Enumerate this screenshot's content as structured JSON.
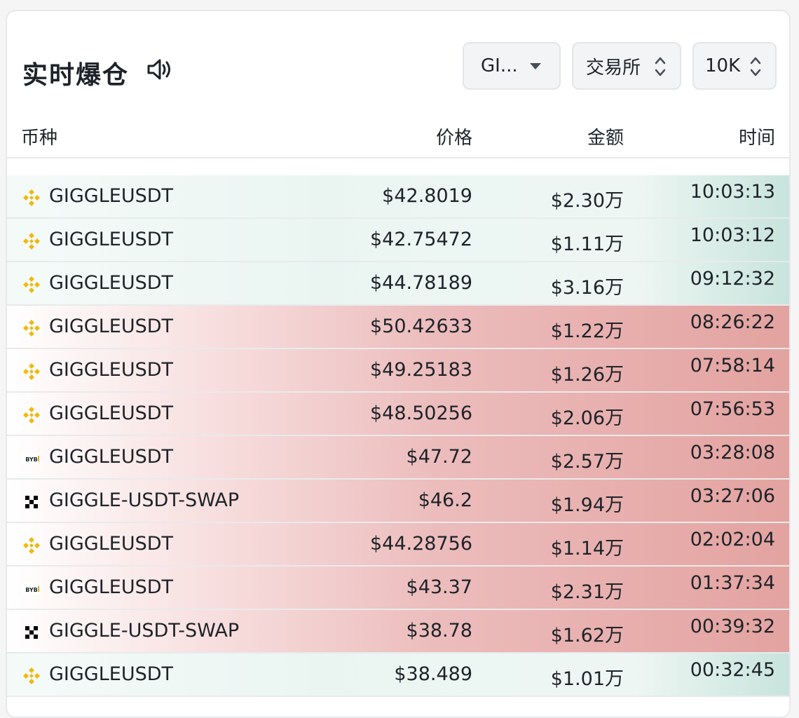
{
  "header": {
    "title": "实时爆仓",
    "coin_filter": "GI...",
    "exchange_filter": "交易所",
    "amount_filter": "10K"
  },
  "columns": [
    "币种",
    "价格",
    "金额",
    "时间"
  ],
  "colors": {
    "long_bg": "#c8e4dc",
    "short_bg": "#e3a3a0",
    "binance": "#f0b90b"
  },
  "rows": [
    {
      "exchange_icon": "binance-icon",
      "side": "long",
      "symbol": "GIGGLEUSDT",
      "price": "$42.8019",
      "amount": "$2.30万",
      "time": "10:03:13"
    },
    {
      "exchange_icon": "binance-icon",
      "side": "long",
      "symbol": "GIGGLEUSDT",
      "price": "$42.75472",
      "amount": "$1.11万",
      "time": "10:03:12"
    },
    {
      "exchange_icon": "binance-icon",
      "side": "long",
      "symbol": "GIGGLEUSDT",
      "price": "$44.78189",
      "amount": "$3.16万",
      "time": "09:12:32"
    },
    {
      "exchange_icon": "binance-icon",
      "side": "short",
      "symbol": "GIGGLEUSDT",
      "price": "$50.42633",
      "amount": "$1.22万",
      "time": "08:26:22"
    },
    {
      "exchange_icon": "binance-icon",
      "side": "short",
      "symbol": "GIGGLEUSDT",
      "price": "$49.25183",
      "amount": "$1.26万",
      "time": "07:58:14"
    },
    {
      "exchange_icon": "binance-icon",
      "side": "short",
      "symbol": "GIGGLEUSDT",
      "price": "$48.50256",
      "amount": "$2.06万",
      "time": "07:56:53"
    },
    {
      "exchange_icon": "bybit-icon",
      "side": "short",
      "symbol": "GIGGLEUSDT",
      "price": "$47.72",
      "amount": "$2.57万",
      "time": "03:28:08"
    },
    {
      "exchange_icon": "okx-icon",
      "side": "short",
      "symbol": "GIGGLE-USDT-SWAP",
      "price": "$46.2",
      "amount": "$1.94万",
      "time": "03:27:06"
    },
    {
      "exchange_icon": "binance-icon",
      "side": "short",
      "symbol": "GIGGLEUSDT",
      "price": "$44.28756",
      "amount": "$1.14万",
      "time": "02:02:04"
    },
    {
      "exchange_icon": "bybit-icon",
      "side": "short",
      "symbol": "GIGGLEUSDT",
      "price": "$43.37",
      "amount": "$2.31万",
      "time": "01:37:34"
    },
    {
      "exchange_icon": "okx-icon",
      "side": "short",
      "symbol": "GIGGLE-USDT-SWAP",
      "price": "$38.78",
      "amount": "$1.62万",
      "time": "00:39:32"
    },
    {
      "exchange_icon": "binance-icon",
      "side": "long",
      "symbol": "GIGGLEUSDT",
      "price": "$38.489",
      "amount": "$1.01万",
      "time": "00:32:45"
    }
  ]
}
